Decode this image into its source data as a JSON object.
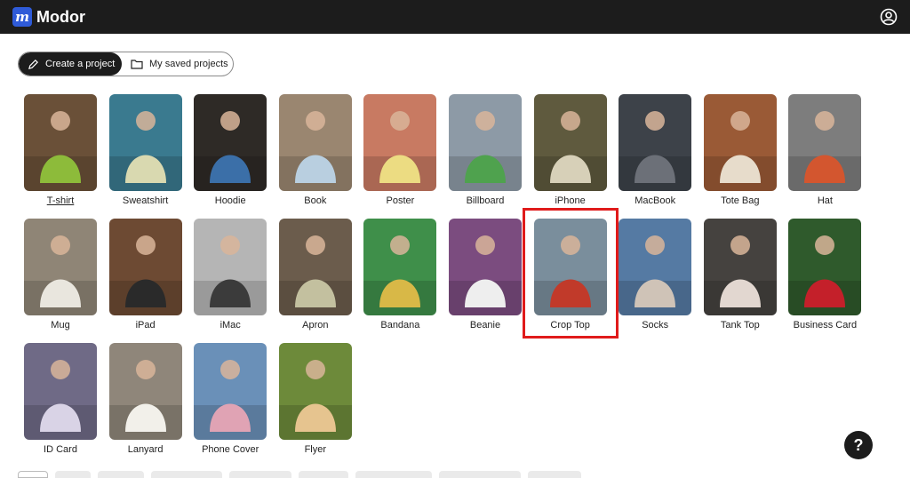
{
  "app": {
    "logo_letter": "m",
    "name": "Modor"
  },
  "header": {
    "account_icon": "account-circle-icon"
  },
  "toggle": {
    "create_label": "Create a project",
    "saved_label": "My saved projects",
    "create_icon": "pencil-icon",
    "saved_icon": "folder-icon"
  },
  "products": [
    {
      "label": "T-shirt",
      "bg": "#6a5038",
      "fg": "#8dbb3a"
    },
    {
      "label": "Sweatshirt",
      "bg": "#3a7a8f",
      "fg": "#d9d9b0"
    },
    {
      "label": "Hoodie",
      "bg": "#2e2a26",
      "fg": "#3b6fa8"
    },
    {
      "label": "Book",
      "bg": "#9a8670",
      "fg": "#b9cfe0"
    },
    {
      "label": "Poster",
      "bg": "#c87a62",
      "fg": "#ecdc82"
    },
    {
      "label": "Billboard",
      "bg": "#8d9aa6",
      "fg": "#4fa24e"
    },
    {
      "label": "iPhone",
      "bg": "#5f5a3e",
      "fg": "#d7d0b8"
    },
    {
      "label": "MacBook",
      "bg": "#3d4249",
      "fg": "#6c7078"
    },
    {
      "label": "Tote Bag",
      "bg": "#9a5a36",
      "fg": "#e7dccb"
    },
    {
      "label": "Hat",
      "bg": "#7d7d7d",
      "fg": "#d3562f"
    },
    {
      "label": "Mug",
      "bg": "#8f8576",
      "fg": "#e9e6de"
    },
    {
      "label": "iPad",
      "bg": "#6d4a33",
      "fg": "#2a2a2a"
    },
    {
      "label": "iMac",
      "bg": "#b5b5b5",
      "fg": "#3b3b3b"
    },
    {
      "label": "Apron",
      "bg": "#6b5c4c",
      "fg": "#c3c09f"
    },
    {
      "label": "Bandana",
      "bg": "#3f8f4a",
      "fg": "#d8b847"
    },
    {
      "label": "Beanie",
      "bg": "#7b4c7f",
      "fg": "#eeeeee"
    },
    {
      "label": "Crop Top",
      "bg": "#7a8e9c",
      "fg": "#c13a2a"
    },
    {
      "label": "Socks",
      "bg": "#557aa3",
      "fg": "#cfc3b7"
    },
    {
      "label": "Tank Top",
      "bg": "#45423f",
      "fg": "#e2d7d0"
    },
    {
      "label": "Business Card",
      "bg": "#2f5a2c",
      "fg": "#c4202a"
    },
    {
      "label": "ID Card",
      "bg": "#6f6a86",
      "fg": "#d9d3e6"
    },
    {
      "label": "Lanyard",
      "bg": "#8f867a",
      "fg": "#f2f0ea"
    },
    {
      "label": "Phone Cover",
      "bg": "#6a90b8",
      "fg": "#e0a3b4"
    },
    {
      "label": "Flyer",
      "bg": "#6d8a3a",
      "fg": "#e6c48f"
    }
  ],
  "selected_product": "Crop Top",
  "help": {
    "label": "?"
  }
}
